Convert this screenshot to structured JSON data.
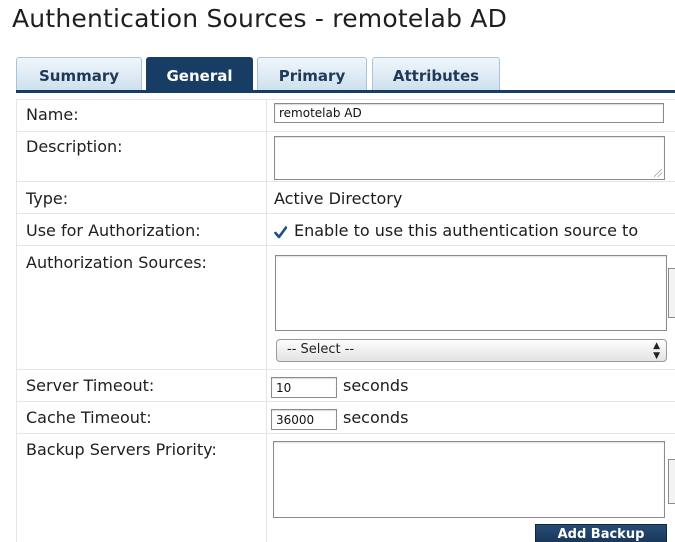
{
  "page": {
    "title": "Authentication Sources - remotelab AD"
  },
  "tabs": [
    {
      "label": "Summary",
      "active": false
    },
    {
      "label": "General",
      "active": true
    },
    {
      "label": "Primary",
      "active": false
    },
    {
      "label": "Attributes",
      "active": false
    }
  ],
  "form": {
    "name": {
      "label": "Name:",
      "value": "remotelab AD"
    },
    "description": {
      "label": "Description:",
      "value": ""
    },
    "type": {
      "label": "Type:",
      "value": "Active Directory"
    },
    "use_for_authorization": {
      "label": "Use for Authorization:",
      "checked": true,
      "text": "Enable to use this authentication source to"
    },
    "authorization_sources": {
      "label": "Authorization Sources:",
      "select_value": "-- Select --"
    },
    "server_timeout": {
      "label": "Server Timeout:",
      "value": "10",
      "unit": "seconds"
    },
    "cache_timeout": {
      "label": "Cache Timeout:",
      "value": "36000",
      "unit": "seconds"
    },
    "backup_servers_priority": {
      "label": "Backup Servers Priority:",
      "add_button_label": "Add Backup"
    }
  },
  "colors": {
    "tab_active_bg": "#173d64",
    "tab_inactive_bg": "#cfe0ee",
    "tab_text": "#1e3a58",
    "row_border": "#dfe6ec",
    "button_bg": "#163454"
  }
}
